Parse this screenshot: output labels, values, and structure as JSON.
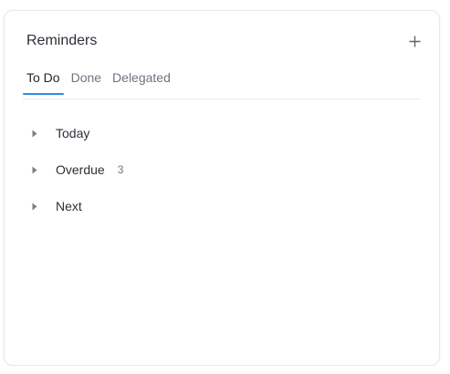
{
  "widget": {
    "title": "Reminders",
    "add_icon": "plus-icon"
  },
  "tabs": [
    {
      "label": "To Do",
      "active": true
    },
    {
      "label": "Done",
      "active": false
    },
    {
      "label": "Delegated",
      "active": false
    }
  ],
  "groups": [
    {
      "label": "Today",
      "count": ""
    },
    {
      "label": "Overdue",
      "count": "3"
    },
    {
      "label": "Next",
      "count": ""
    }
  ],
  "colors": {
    "accent": "#2f89e8",
    "text": "#2b2f36",
    "muted": "#6d7480"
  }
}
